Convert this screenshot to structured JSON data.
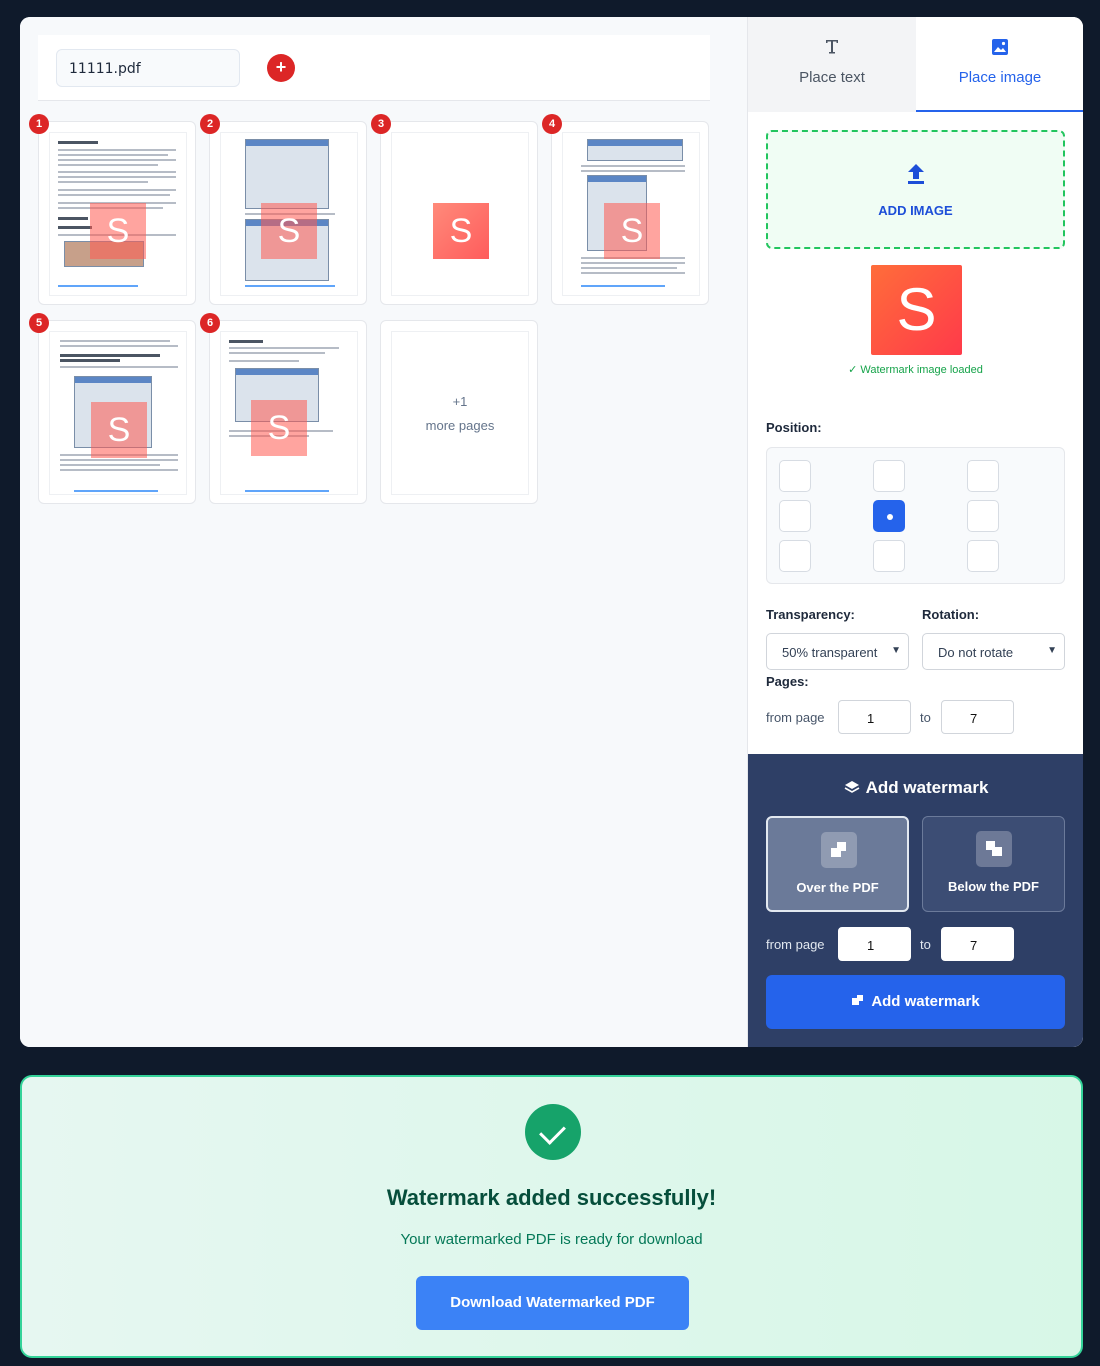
{
  "file": {
    "name": "11111.pdf",
    "add_icon": "plus-icon"
  },
  "pages": [
    {
      "number": "1"
    },
    {
      "number": "2"
    },
    {
      "number": "3"
    },
    {
      "number": "4"
    },
    {
      "number": "5"
    },
    {
      "number": "6"
    }
  ],
  "watermark_letter": "S",
  "more_pages": {
    "count": "+1",
    "label": "more pages"
  },
  "tabs": [
    {
      "label": "Place text",
      "icon": "text-icon"
    },
    {
      "label": "Place image",
      "icon": "image-icon",
      "active": true
    }
  ],
  "upload": {
    "label": "ADD IMAGE",
    "icon": "upload-icon"
  },
  "preview": {
    "letter": "S",
    "status": "✓ Watermark image loaded"
  },
  "position": {
    "label": "Position:",
    "selected": "center"
  },
  "transparency": {
    "label": "Transparency:",
    "value": "50% transparent"
  },
  "rotation": {
    "label": "Rotation:",
    "value": "Do not rotate"
  },
  "pages_range": {
    "label": "Pages:",
    "from_label": "from page",
    "from": "1",
    "to_label": "to",
    "to": "7"
  },
  "add_panel": {
    "title": "Add watermark",
    "modes": [
      {
        "label": "Over the PDF",
        "active": true
      },
      {
        "label": "Below the PDF",
        "active": false
      }
    ],
    "from_label": "from page",
    "from": "1",
    "to_label": "to",
    "to": "7",
    "button": "Add watermark"
  },
  "success": {
    "title": "Watermark added successfully!",
    "subtitle": "Your watermarked PDF is ready for download",
    "button": "Download Watermarked PDF"
  },
  "colors": {
    "accent": "#2563eb",
    "success": "#16a36a",
    "badge": "#dc2626",
    "panel": "#2e3f66"
  }
}
